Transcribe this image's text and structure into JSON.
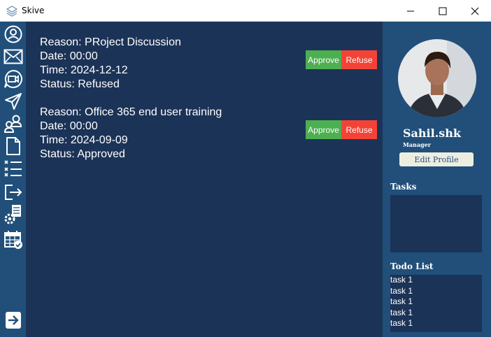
{
  "window": {
    "title": "Skive"
  },
  "requests": [
    {
      "reason": "Reason: PRoject Discussion",
      "date": "Date: 00:00",
      "time": "Time: 2024-12-12",
      "status": "Status: Refused",
      "approve_label": "Approve",
      "refuse_label": "Refuse"
    },
    {
      "reason": "Reason: Office 365 end user training",
      "date": "Date: 00:00",
      "time": "Time: 2024-09-09",
      "status": "Status: Approved",
      "approve_label": "Approve",
      "refuse_label": "Refuse"
    }
  ],
  "profile": {
    "name": "Sahil.shk",
    "role": "Manager",
    "edit_label": "Edit Profile"
  },
  "tasks": {
    "label": "Tasks"
  },
  "todo": {
    "label": "Todo List",
    "items": [
      "task 1",
      "task 1",
      "task 1",
      "task 1",
      "task 1"
    ]
  },
  "sidebar": {
    "icons": [
      "profile-icon",
      "mail-icon",
      "video-call-icon",
      "send-icon",
      "users-icon",
      "document-icon",
      "checklist-icon",
      "logout-icon",
      "settings-report-icon",
      "calendar-check-icon",
      "arrow-right-icon"
    ]
  },
  "colors": {
    "main_bg": "#1b3357",
    "sidebar_bg": "#214f7a",
    "approve": "#4caf50",
    "refuse": "#f44336"
  }
}
